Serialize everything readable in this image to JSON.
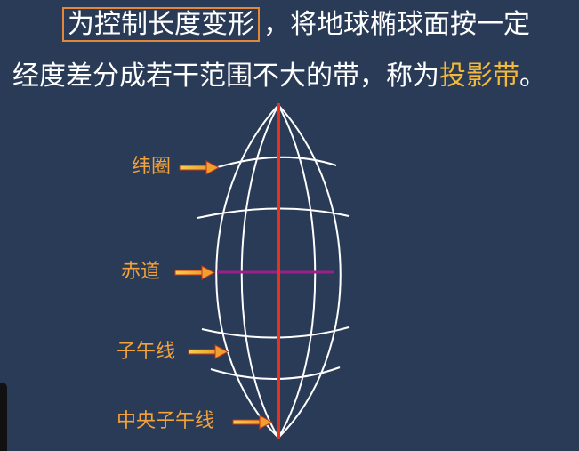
{
  "heading": {
    "line1_boxed": "为控制长度变形",
    "line1_rest": "，将地球椭球面按一定",
    "line2_main": "经度差分成若干范围不大的带，称为",
    "line2_highlight": "投影带",
    "line2_end": "。"
  },
  "labels": {
    "parallel": "纬圈",
    "equator": "赤道",
    "meridian": "子午线",
    "central_meridian": "中央子午线"
  },
  "colors": {
    "background": "#2a3b57",
    "grid": "#ffffff",
    "central_meridian": "#e8321e",
    "equator": "#9b1e8a",
    "label": "#f3a33a",
    "highlight": "#f3b93a",
    "box_border": "#e3873a"
  }
}
